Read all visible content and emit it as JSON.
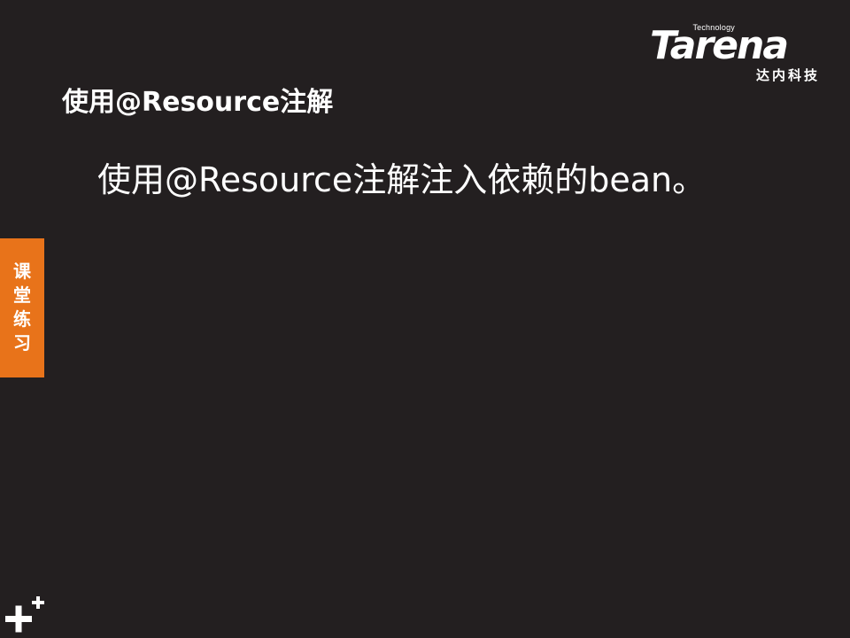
{
  "logo": {
    "tagline": "Technology",
    "brand": "Tarena",
    "brand_cn": "达内科技"
  },
  "slide": {
    "title": "使用@Resource注解",
    "body": "使用@Resource注解注入依赖的bean。"
  },
  "side_tab": {
    "chars": [
      "课",
      "堂",
      "练",
      "习"
    ]
  },
  "decoration": {
    "icon": "plus-icon"
  },
  "colors": {
    "background": "#231f20",
    "accent": "#e8731a",
    "text": "#ffffff"
  }
}
